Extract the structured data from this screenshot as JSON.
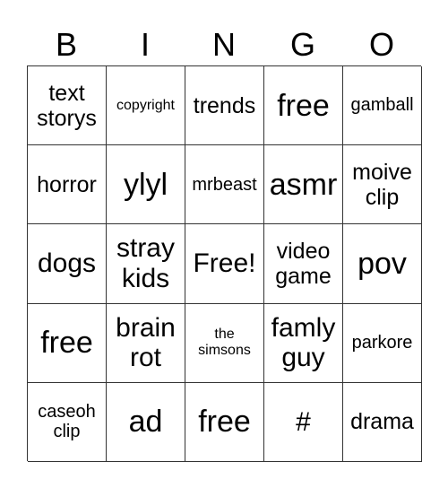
{
  "header": {
    "letters": [
      "B",
      "I",
      "N",
      "G",
      "O"
    ]
  },
  "grid": {
    "rows": [
      [
        {
          "text": "text storys",
          "size": "md"
        },
        {
          "text": "copyright",
          "size": "xs"
        },
        {
          "text": "trends",
          "size": "md"
        },
        {
          "text": "free",
          "size": "xl"
        },
        {
          "text": "gamball",
          "size": "sm"
        }
      ],
      [
        {
          "text": "horror",
          "size": "md"
        },
        {
          "text": "ylyl",
          "size": "xl"
        },
        {
          "text": "mrbeast",
          "size": "sm"
        },
        {
          "text": "asmr",
          "size": "xl"
        },
        {
          "text": "moive clip",
          "size": "md"
        }
      ],
      [
        {
          "text": "dogs",
          "size": "lg"
        },
        {
          "text": "stray kids",
          "size": "lg"
        },
        {
          "text": "Free!",
          "size": "lg"
        },
        {
          "text": "video game",
          "size": "md"
        },
        {
          "text": "pov",
          "size": "xl"
        }
      ],
      [
        {
          "text": "free",
          "size": "xl"
        },
        {
          "text": "brain rot",
          "size": "lg"
        },
        {
          "text": "the simsons",
          "size": "xs"
        },
        {
          "text": "famly guy",
          "size": "lg"
        },
        {
          "text": "parkore",
          "size": "sm"
        }
      ],
      [
        {
          "text": "caseoh clip",
          "size": "sm"
        },
        {
          "text": "ad",
          "size": "xl"
        },
        {
          "text": "free",
          "size": "xl"
        },
        {
          "text": "#",
          "size": "lg"
        },
        {
          "text": "drama",
          "size": "md"
        }
      ]
    ]
  }
}
